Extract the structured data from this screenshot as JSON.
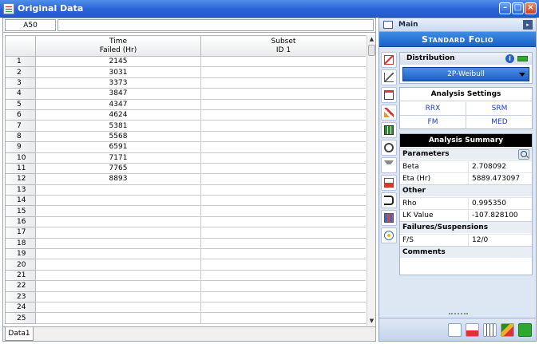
{
  "window": {
    "title": "Original Data"
  },
  "formula_bar": {
    "cell_ref": "A50",
    "value": ""
  },
  "sheet": {
    "headers": [
      {
        "line1": "Time",
        "line2": "Failed (Hr)"
      },
      {
        "line1": "Subset",
        "line2": "ID 1"
      }
    ],
    "rows": [
      {
        "num": "1",
        "time": "2145",
        "subset": ""
      },
      {
        "num": "2",
        "time": "3031",
        "subset": ""
      },
      {
        "num": "3",
        "time": "3373",
        "subset": ""
      },
      {
        "num": "4",
        "time": "3847",
        "subset": ""
      },
      {
        "num": "5",
        "time": "4347",
        "subset": ""
      },
      {
        "num": "6",
        "time": "4624",
        "subset": ""
      },
      {
        "num": "7",
        "time": "5381",
        "subset": ""
      },
      {
        "num": "8",
        "time": "5568",
        "subset": ""
      },
      {
        "num": "9",
        "time": "6591",
        "subset": ""
      },
      {
        "num": "10",
        "time": "7171",
        "subset": ""
      },
      {
        "num": "11",
        "time": "7765",
        "subset": ""
      },
      {
        "num": "12",
        "time": "8893",
        "subset": ""
      },
      {
        "num": "13",
        "time": "",
        "subset": ""
      },
      {
        "num": "14",
        "time": "",
        "subset": ""
      },
      {
        "num": "15",
        "time": "",
        "subset": ""
      },
      {
        "num": "16",
        "time": "",
        "subset": ""
      },
      {
        "num": "17",
        "time": "",
        "subset": ""
      },
      {
        "num": "18",
        "time": "",
        "subset": ""
      },
      {
        "num": "19",
        "time": "",
        "subset": ""
      },
      {
        "num": "20",
        "time": "",
        "subset": ""
      },
      {
        "num": "21",
        "time": "",
        "subset": ""
      },
      {
        "num": "22",
        "time": "",
        "subset": ""
      },
      {
        "num": "23",
        "time": "",
        "subset": ""
      },
      {
        "num": "24",
        "time": "",
        "subset": ""
      },
      {
        "num": "25",
        "time": "",
        "subset": ""
      }
    ],
    "tab": "Data1"
  },
  "panel": {
    "header": "Main",
    "banner": "Standard Folio",
    "distribution": {
      "label": "Distribution",
      "selected": "2P-Weibull",
      "info_icon": "i"
    },
    "settings": {
      "title": "Analysis Settings",
      "cells": [
        "RRX",
        "SRM",
        "FM",
        "MED"
      ]
    },
    "summary": {
      "title": "Analysis Summary",
      "parameters_label": "Parameters",
      "beta_label": "Beta",
      "beta_value": "2.708092",
      "eta_label": "Eta (Hr)",
      "eta_value": "5889.473097",
      "other_label": "Other",
      "rho_label": "Rho",
      "rho_value": "0.995350",
      "lk_label": "LK Value",
      "lk_value": "-107.828100",
      "fs_section_label": "Failures/Suspensions",
      "fs_label": "F/S",
      "fs_value": "12/0",
      "comments_label": "Comments"
    }
  },
  "icons": {
    "minimize": "minimize-icon",
    "maximize": "maximize-icon",
    "close": "close-icon",
    "scroll_up": "▲",
    "scroll_down": "▼",
    "pane_arrow": "▸"
  },
  "colors": {
    "accent": "#1d5fc6",
    "title_bar": "#2a64d8",
    "link": "#1b3bd0",
    "ok": "#2ea82e"
  }
}
